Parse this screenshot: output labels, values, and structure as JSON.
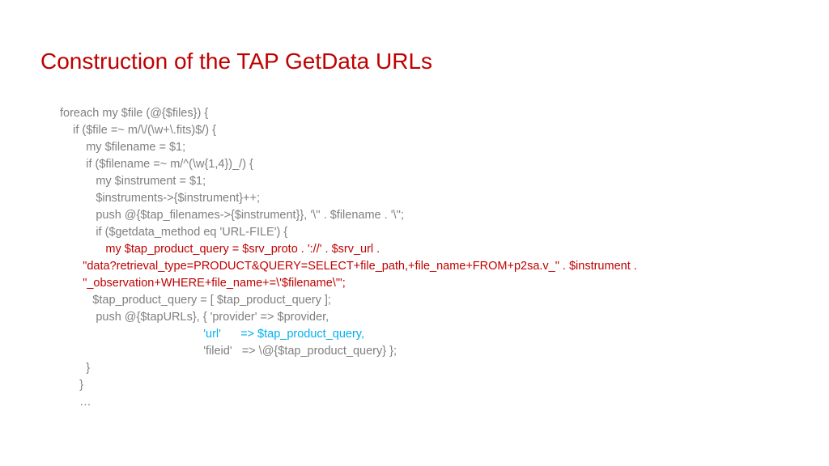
{
  "title": "Construction of the TAP GetData URLs",
  "code": {
    "l1": "foreach my $file (@{$files}) {",
    "l2": "    if ($file =~ m/\\/(\\w+\\.fits)$/) {",
    "l3": "        my $filename = $1;",
    "l4": "        if ($filename =~ m/^(\\w{1,4})_/) {",
    "l5": "           my $instrument = $1;",
    "l6": "           $instruments->{$instrument}++;",
    "l7": "           push @{$tap_filenames->{$instrument}}, '\\'' . $filename . '\\'';",
    "l8": "           if ($getdata_method eq 'URL-FILE') {",
    "l9": "              my $tap_product_query = $srv_proto . '://' . $srv_url .",
    "l10": "       \"data?retrieval_type=PRODUCT&QUERY=SELECT+file_path,+file_name+FROM+p2sa.v_\" . $instrument .",
    "l11": "       \"_observation+WHERE+file_name+=\\'$filename\\'\";",
    "l12": "          $tap_product_query = [ $tap_product_query ];",
    "l13": "           push @{$tapURLs}, { 'provider' => $provider,",
    "l14": "                                            'url'      => $tap_product_query,",
    "l15": "                                            'fileid'   => \\@{$tap_product_query} };",
    "l16": "        }",
    "l17": "      }",
    "l18": "      …"
  }
}
